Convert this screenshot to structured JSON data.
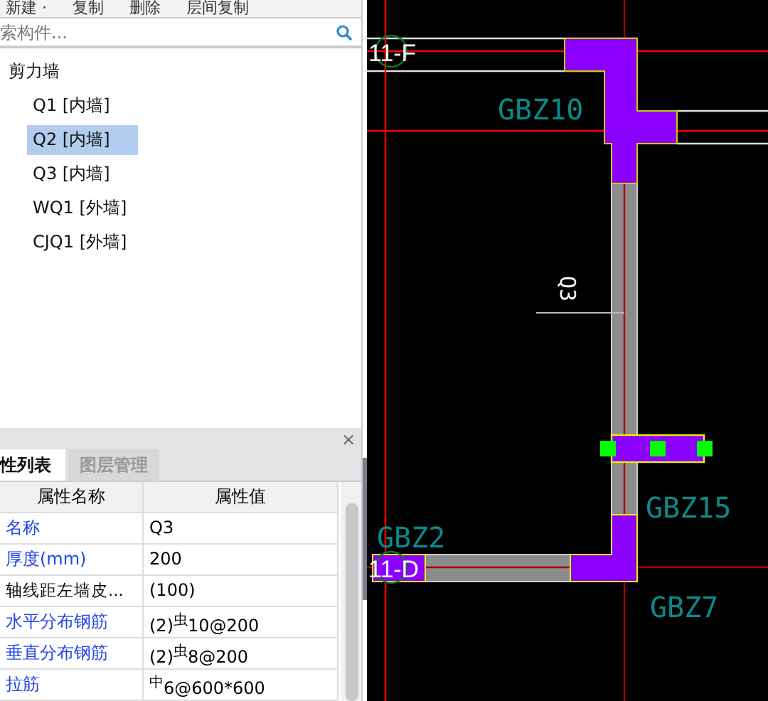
{
  "toolbar": [
    "新建 ·",
    "复制",
    "删除",
    "层间复制"
  ],
  "search": {
    "placeholder": "索构件..."
  },
  "tree": [
    {
      "label": "剪力墙",
      "selected": false,
      "children": [
        {
          "label": "Q1 [内墙]",
          "selected": false
        },
        {
          "label": "Q2 [内墙]",
          "selected": true
        },
        {
          "label": "Q3 [内墙]",
          "selected": false
        },
        {
          "label": "WQ1 [外墙]",
          "selected": false
        },
        {
          "label": "CJQ1 [外墙]",
          "selected": false
        }
      ]
    }
  ],
  "panel": {
    "close": "×",
    "tabs": [
      {
        "label": "性列表",
        "selected": true
      },
      {
        "label": "图层管理",
        "selected": false
      }
    ],
    "columns": [
      "属性名称",
      "属性值"
    ],
    "rows": [
      {
        "name": "名称",
        "value": "Q3",
        "kind": "common"
      },
      {
        "name": "厚度(mm)",
        "value": "200",
        "kind": "common"
      },
      {
        "name": "轴线距左墙皮...",
        "value": "(100)",
        "kind": "private"
      },
      {
        "name": "水平分布钢筋",
        "value": "(2)$^{虫}$10@200",
        "kind": "common"
      },
      {
        "name": "垂直分布钢筋",
        "value": "(2)$^{虫}$8@200",
        "kind": "common"
      },
      {
        "name": "拉筋",
        "value": "$^{中}$6@600*600",
        "kind": "common"
      }
    ]
  },
  "drawing": {
    "axes": [
      {
        "label": "11-F"
      },
      {
        "label": "11-D"
      }
    ],
    "wall_label": "Q3",
    "columns": [
      {
        "label": "GBZ10"
      },
      {
        "label": "GBZ15"
      },
      {
        "label": "GBZ2"
      },
      {
        "label": "GBZ7"
      }
    ]
  }
}
